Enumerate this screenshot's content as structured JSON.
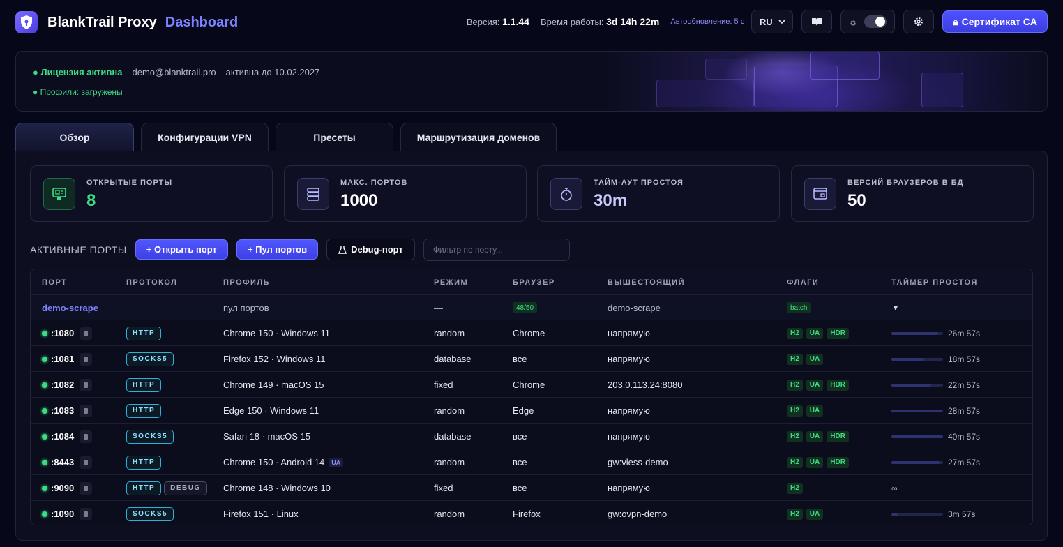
{
  "header": {
    "brand": "BlankTrail Proxy",
    "brand_sub": "Dashboard",
    "version_label": "Версия:",
    "version": "1.1.44",
    "uptime_label": "Время работы:",
    "uptime": "3d 14h 22m",
    "autorefresh": "Автообновление: 5 с",
    "lang": "RU",
    "ca_button": "Сертификат CA",
    "icons": [
      "shield-logo-icon",
      "book-icon",
      "sun-icon",
      "gear-icon",
      "lock-icon"
    ]
  },
  "license": {
    "status": "● Лицензия активна",
    "email": "demo@blanktrail.pro",
    "expires": "активна до 10.02.2027",
    "profiles": "● Профили: загружены"
  },
  "tabs": [
    "Обзор",
    "Конфигурации VPN",
    "Пресеты",
    "Маршрутизация доменов"
  ],
  "stats": [
    {
      "label": "ОТКРЫТЫЕ ПОРТЫ",
      "value": "8",
      "icon": "monitor-icon"
    },
    {
      "label": "МАКС. ПОРТОВ",
      "value": "1000",
      "icon": "server-icon"
    },
    {
      "label": "ТАЙМ-АУТ ПРОСТОЯ",
      "value": "30m",
      "icon": "stopwatch-icon"
    },
    {
      "label": "ВЕРСИЙ БРАУЗЕРОВ В БД",
      "value": "50",
      "icon": "browser-icon"
    }
  ],
  "toolbar": {
    "title": "АКТИВНЫЕ ПОРТЫ",
    "open_port": "+ Открыть порт",
    "port_pool": "+ Пул портов",
    "debug_port": "Debug-порт",
    "filter_placeholder": "Фильтр по порту..."
  },
  "table": {
    "headers": [
      "ПОРТ",
      "ПРОТОКОЛ",
      "ПРОФИЛЬ",
      "РЕЖИМ",
      "БРАУЗЕР",
      "ВЫШЕСТОЯЩИЙ",
      "ФЛАГИ",
      "ТАЙМЕР ПРОСТОЯ"
    ],
    "pool": {
      "name": "demo-scrape",
      "profile": "пул портов",
      "mode": "—",
      "browser": "48/50",
      "upstream": "demo-scrape",
      "flag": "batch",
      "caret": "▼"
    },
    "rows": [
      {
        "port": ":1080",
        "proto": "HTTP",
        "profile": "Chrome 150 · Windows 11",
        "mode": "random",
        "browser": "Chrome",
        "upstream": "напрямую",
        "flags": [
          "H2",
          "UA",
          "HDR"
        ],
        "timer": "26m 57s",
        "fill": 0.9
      },
      {
        "port": ":1081",
        "proto": "SOCKS5",
        "profile": "Firefox 152 · Windows 11",
        "mode": "database",
        "browser": "все",
        "upstream": "напрямую",
        "flags": [
          "H2",
          "UA"
        ],
        "timer": "18m 57s",
        "fill": 0.63
      },
      {
        "port": ":1082",
        "proto": "HTTP",
        "profile": "Chrome 149 · macOS 15",
        "mode": "fixed",
        "browser": "Chrome",
        "upstream": "203.0.113.24:8080",
        "flags": [
          "H2",
          "UA",
          "HDR"
        ],
        "timer": "22m 57s",
        "fill": 0.77
      },
      {
        "port": ":1083",
        "proto": "HTTP",
        "profile": "Edge 150 · Windows 11",
        "mode": "random",
        "browser": "Edge",
        "upstream": "напрямую",
        "flags": [
          "H2",
          "UA"
        ],
        "timer": "28m 57s",
        "fill": 0.97
      },
      {
        "port": ":1084",
        "proto": "SOCKS5",
        "profile": "Safari 18 · macOS 15",
        "mode": "database",
        "browser": "все",
        "upstream": "напрямую",
        "flags": [
          "H2",
          "UA",
          "HDR"
        ],
        "timer": "40m 57s",
        "fill": 1
      },
      {
        "port": ":8443",
        "proto": "HTTP",
        "profile": "Chrome 150 · Android 14",
        "profile_badge": "UA",
        "mode": "random",
        "browser": "все",
        "upstream": "gw:vless-demo",
        "flags": [
          "H2",
          "UA",
          "HDR"
        ],
        "timer": "27m 57s",
        "fill": 0.93
      },
      {
        "port": ":9090",
        "proto": "HTTP",
        "proto2": "DEBUG",
        "profile": "Chrome 148 · Windows 10",
        "mode": "fixed",
        "browser": "все",
        "upstream": "напрямую",
        "flags": [
          "H2"
        ],
        "timer": "∞",
        "fill": null
      },
      {
        "port": ":1090",
        "proto": "SOCKS5",
        "profile": "Firefox 151 · Linux",
        "mode": "random",
        "browser": "Firefox",
        "upstream": "gw:ovpn-demo",
        "flags": [
          "H2",
          "UA"
        ],
        "timer": "3m 57s",
        "fill": 0.13
      }
    ]
  }
}
